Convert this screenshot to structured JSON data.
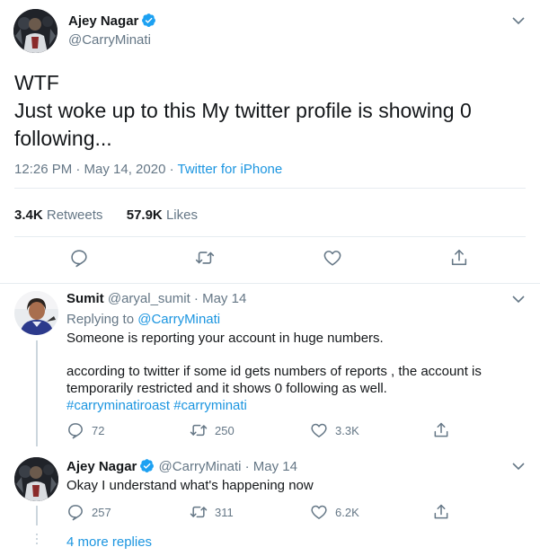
{
  "main_tweet": {
    "name": "Ajey Nagar",
    "handle": "@CarryMinati",
    "text_line1": "WTF",
    "text_line2": "Just woke up to this My twitter profile is showing 0 following...",
    "time": "12:26 PM · May 14, 2020 · ",
    "client": "Twitter for iPhone",
    "retweets_count": "3.4K",
    "retweets_label": "Retweets",
    "likes_count": "57.9K",
    "likes_label": "Likes"
  },
  "replies": [
    {
      "name": "Sumit",
      "handle": "@aryal_sumit · May 14",
      "replying_prefix": "Replying to ",
      "replying_to": "@CarryMinati",
      "line1": "Someone is reporting your account in huge numbers.",
      "line2": "according to twitter if some id gets numbers of reports , the account is temporarily restricted and it shows 0 following as well.",
      "hashtags": "#carryminatiroast #carryminati",
      "replies": "72",
      "retweets": "250",
      "likes": "3.3K"
    },
    {
      "name": "Ajey Nagar",
      "handle": "@CarryMinati · May 14",
      "text": "Okay I understand what's happening now",
      "replies": "257",
      "retweets": "311",
      "likes": "6.2K"
    }
  ],
  "more_replies": "4 more replies",
  "colors": {
    "text": "#14171a",
    "secondary": "#657786",
    "link": "#1b95e0",
    "verified": "#1da1f2",
    "border": "#e6ecf0"
  },
  "icons": [
    "reply-icon",
    "retweet-icon",
    "like-icon",
    "share-icon",
    "verified-icon",
    "chevron-down-icon"
  ]
}
